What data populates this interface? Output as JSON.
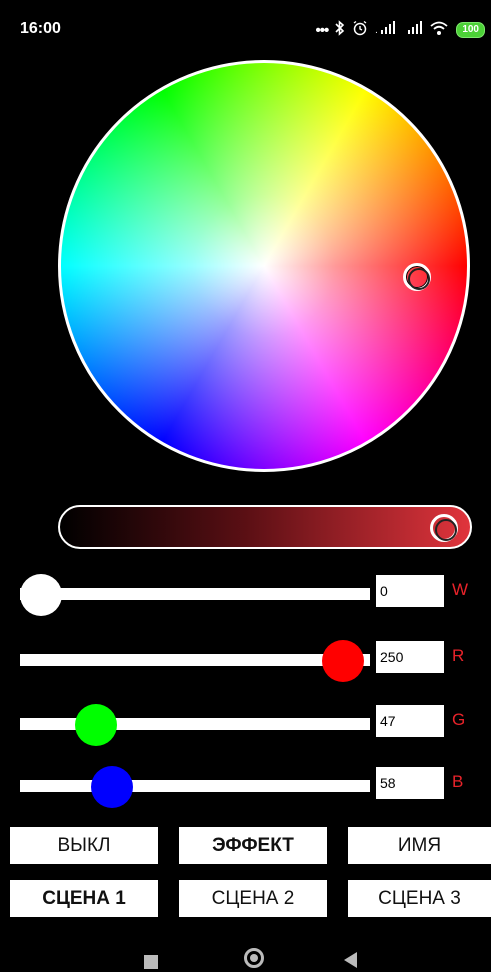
{
  "status_bar": {
    "time": "16:00",
    "icons": [
      "more-dots-icon",
      "bluetooth-icon",
      "alarm-icon",
      "signal-icon",
      "signal-icon",
      "wifi-icon"
    ],
    "battery": "100"
  },
  "color_picker": {
    "selected_color": "#ff0a2f"
  },
  "sliders": [
    {
      "channel": "W",
      "value": "0",
      "level": 0.0,
      "color": "#ffffff"
    },
    {
      "channel": "R",
      "value": "250",
      "level": 0.98,
      "color": "#ff0000"
    },
    {
      "channel": "G",
      "value": "47",
      "level": 0.18,
      "color": "#00ff00"
    },
    {
      "channel": "B",
      "value": "58",
      "level": 0.23,
      "color": "#0000ff"
    }
  ],
  "buttons": {
    "off": "ВЫКЛ",
    "effect": "ЭФФЕКТ",
    "name": "ИМЯ",
    "scene1": "СЦЕНА 1",
    "scene2": "СЦЕНА 2",
    "scene3": "СЦЕНА 3"
  },
  "nav": [
    "recents-icon",
    "home-icon",
    "back-icon"
  ]
}
